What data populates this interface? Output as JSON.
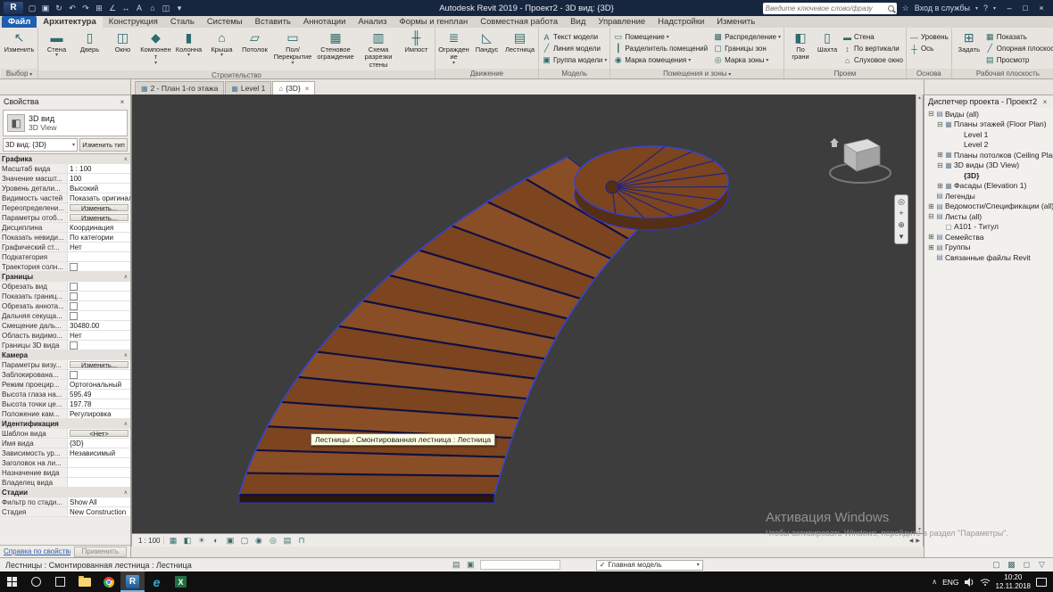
{
  "colors": {
    "titlebar": "#17263f",
    "ribbon_bg": "#e8e5e0",
    "canvas_bg": "#3d3d3d",
    "file_tab": "#1f5fae",
    "tread_brown": "#7c441f",
    "selection_blue": "#3644d0",
    "taskbar_accent": "#76b9ed"
  },
  "titlebar": {
    "app_label": "R",
    "qat": [
      {
        "name": "open",
        "glyph": "▢"
      },
      {
        "name": "save",
        "glyph": "▣"
      },
      {
        "name": "sync",
        "glyph": "↻"
      },
      {
        "name": "undo",
        "glyph": "↶"
      },
      {
        "name": "redo",
        "glyph": "↷"
      },
      {
        "name": "print",
        "glyph": "⊞"
      },
      {
        "name": "measure",
        "glyph": "∠"
      },
      {
        "name": "dimension",
        "glyph": "↔"
      },
      {
        "name": "text",
        "glyph": "A"
      },
      {
        "name": "3d-view",
        "glyph": "⌂"
      },
      {
        "name": "section",
        "glyph": "◫"
      },
      {
        "name": "customize",
        "glyph": "▾"
      }
    ],
    "title": "Autodesk Revit 2019 - Проект2 - 3D вид: {3D}",
    "search_placeholder": "Введите ключевое слово/фразу",
    "star": "☆",
    "signin": "Вход в службы",
    "help": "?",
    "win": {
      "min": "–",
      "max": "□",
      "close": "×"
    }
  },
  "ribbon": {
    "tabs": [
      {
        "label": "Файл",
        "file": true
      },
      {
        "label": "Архитектура",
        "active": true
      },
      {
        "label": "Конструкция"
      },
      {
        "label": "Сталь"
      },
      {
        "label": "Системы"
      },
      {
        "label": "Вставить"
      },
      {
        "label": "Аннотации"
      },
      {
        "label": "Анализ"
      },
      {
        "label": "Формы и генплан"
      },
      {
        "label": "Совместная работа"
      },
      {
        "label": "Вид"
      },
      {
        "label": "Управление"
      },
      {
        "label": "Надстройки"
      },
      {
        "label": "Изменить"
      }
    ],
    "panels": [
      {
        "label": "Выбор",
        "items": [
          {
            "label": "Изменить",
            "glyph": "↖"
          }
        ]
      },
      {
        "label": "Строительство",
        "items": [
          {
            "label": "Стена",
            "glyph": "▬",
            "arrow": true
          },
          {
            "label": "Дверь",
            "glyph": "▯"
          },
          {
            "label": "Окно",
            "glyph": "◫"
          },
          {
            "label": "Компонент",
            "glyph": "◆",
            "arrow": true
          },
          {
            "label": "Колонна",
            "glyph": "▮",
            "arrow": true
          },
          {
            "label": "Крыша",
            "glyph": "⌂",
            "arrow": true
          },
          {
            "label": "Потолок",
            "glyph": "▱"
          },
          {
            "label": "Пол/Перекрытие",
            "glyph": "▭",
            "arrow": true,
            "wide": true
          },
          {
            "label": "Стеновое ограждение",
            "glyph": "▦",
            "wide": true
          },
          {
            "label": "Схема разрезки стены",
            "glyph": "▥",
            "wide": true
          },
          {
            "label": "Импост",
            "glyph": "╫"
          }
        ]
      },
      {
        "label": "Движение",
        "items": [
          {
            "label": "Ограждение",
            "glyph": "≣",
            "arrow": true
          },
          {
            "label": "Пандус",
            "glyph": "◺"
          },
          {
            "label": "Лестница",
            "glyph": "▤"
          }
        ]
      },
      {
        "label": "Модель",
        "items": [
          {
            "label": "Текст модели",
            "glyph": "А"
          },
          {
            "label": "Линия модели",
            "glyph": "╱"
          },
          {
            "label": "Группа модели",
            "glyph": "▣",
            "arrow": true
          }
        ]
      },
      {
        "label": "Помещения и зоны",
        "arrow": true,
        "items": [
          {
            "label": "Помещение",
            "glyph": "▭",
            "arrow": true
          },
          {
            "label": "Разделитель помещений",
            "glyph": "┃"
          },
          {
            "label": "Марка помещения",
            "glyph": "◉",
            "arrow": true
          },
          {
            "label": "Распределение",
            "glyph": "▩",
            "arrow": true
          },
          {
            "label": "Границы зон",
            "glyph": "▢"
          },
          {
            "label": "Марка зоны",
            "glyph": "◎",
            "arrow": true
          }
        ]
      },
      {
        "label": "Проем",
        "big": [
          {
            "label": "По грани",
            "glyph": "◧"
          },
          {
            "label": "Шахта",
            "glyph": "▯"
          }
        ],
        "small": [
          {
            "label": "Стена",
            "glyph": "▬"
          },
          {
            "label": "По вертикали",
            "glyph": "↕"
          },
          {
            "label": "Слуховое окно",
            "glyph": "⌂"
          }
        ]
      },
      {
        "label": "Основа",
        "items": [
          {
            "label": "Уровень",
            "glyph": "—"
          },
          {
            "label": "Ось",
            "glyph": "┼"
          }
        ]
      },
      {
        "label": "Рабочая плоскость",
        "big": [
          {
            "label": "Задать",
            "glyph": "⊞"
          }
        ],
        "small": [
          {
            "label": "Показать",
            "glyph": "▦"
          },
          {
            "label": "Опорная плоскость",
            "glyph": "╱"
          },
          {
            "label": "Просмотр",
            "glyph": "▤"
          }
        ]
      }
    ]
  },
  "properties": {
    "title": "Свойства",
    "close": "×",
    "type_selector": {
      "line1": "3D вид",
      "line2": "3D View",
      "icon_glyph": "◧"
    },
    "instance_combo": "3D вид: {3D}",
    "edit_type": "Изменить тип",
    "rows": [
      {
        "is_section": true,
        "label": "Графика"
      },
      {
        "label": "Масштаб вида",
        "value": "1 : 100"
      },
      {
        "label": "Значение масшт...",
        "value": "100"
      },
      {
        "label": "Уровень детали...",
        "value": "Высокий"
      },
      {
        "label": "Видимость частей",
        "value": "Показать оригинал"
      },
      {
        "label": "Переопределени...",
        "value": "Изменить...",
        "is_button": true
      },
      {
        "label": "Параметры отоб...",
        "value": "Изменить...",
        "is_button": true
      },
      {
        "label": "Дисциплина",
        "value": "Координация"
      },
      {
        "label": "Показать невиди...",
        "value": "По категории"
      },
      {
        "label": "Графический ст...",
        "value": "Нет"
      },
      {
        "label": "Подкатегория",
        "value": ""
      },
      {
        "label": "Траектория солн...",
        "is_checkbox": true
      },
      {
        "is_section": true,
        "label": "Границы"
      },
      {
        "label": "Обрезать вид",
        "is_checkbox": true
      },
      {
        "label": "Показать границ...",
        "is_checkbox": true
      },
      {
        "label": "Обрезать аннота...",
        "is_checkbox": true
      },
      {
        "label": "Дальняя секуща...",
        "is_checkbox": true
      },
      {
        "label": "Смещение даль...",
        "value": "30480.00"
      },
      {
        "label": "Область видимо...",
        "value": "Нет"
      },
      {
        "label": "Границы 3D вида",
        "is_checkbox": true
      },
      {
        "is_section": true,
        "label": "Камера"
      },
      {
        "label": "Параметры визу...",
        "value": "Изменить...",
        "is_button": true
      },
      {
        "label": "Заблокирована...",
        "is_checkbox": true
      },
      {
        "label": "Режим проецир...",
        "value": "Ортогональный"
      },
      {
        "label": "Высота глаза на...",
        "value": "595.49"
      },
      {
        "label": "Высота точки це...",
        "value": "197.78"
      },
      {
        "label": "Положение кам...",
        "value": "Регулировка"
      },
      {
        "is_section": true,
        "label": "Идентификация"
      },
      {
        "label": "Шаблон вида",
        "value": "<Нет>",
        "is_button": true
      },
      {
        "label": "Имя вида",
        "value": "{3D}"
      },
      {
        "label": "Зависимость ур...",
        "value": "Независимый"
      },
      {
        "label": "Заголовок на ли...",
        "value": ""
      },
      {
        "label": "Назначение вида",
        "value": ""
      },
      {
        "label": "Владелец вида",
        "value": ""
      },
      {
        "is_section": true,
        "label": "Стадии"
      },
      {
        "label": "Фильтр по стади...",
        "value": "Show All"
      },
      {
        "label": "Стадия",
        "value": "New Construction"
      }
    ],
    "footer": {
      "help": "Справка по свойствам",
      "apply": "Применить"
    }
  },
  "viewtabs": [
    {
      "icon": "▦",
      "label": "2 - План 1-го этажа"
    },
    {
      "icon": "▦",
      "label": "Level 1"
    },
    {
      "icon": "⌂",
      "label": "{3D}",
      "active": true
    }
  ],
  "canvas": {
    "tooltip": "Лестницы : Смонтированная лестница : Лестница",
    "navbar": [
      {
        "name": "steering-wheel",
        "glyph": "◎"
      },
      {
        "name": "pan",
        "glyph": "+"
      },
      {
        "name": "zoom",
        "glyph": "⊕"
      },
      {
        "name": "more",
        "glyph": "▾"
      }
    ],
    "vscroll": {
      "up": "▲",
      "down": "▼"
    }
  },
  "viewbar": {
    "scale": "1 : 100",
    "icons": [
      {
        "name": "detail-level",
        "glyph": "▦"
      },
      {
        "name": "visual-style",
        "glyph": "◧"
      },
      {
        "name": "sun-path",
        "glyph": "☀"
      },
      {
        "name": "shadows",
        "glyph": "◐"
      },
      {
        "name": "crop-view",
        "glyph": "▣"
      },
      {
        "name": "show-crop",
        "glyph": "▢"
      },
      {
        "name": "temporary-hide-isolate",
        "glyph": "◉"
      },
      {
        "name": "reveal-hidden",
        "glyph": "◎"
      },
      {
        "name": "temporary-view-properties",
        "glyph": "▤"
      },
      {
        "name": "show-constraints",
        "glyph": "⊓"
      }
    ],
    "scroll_left": "◀",
    "scroll_right": "▶"
  },
  "browser": {
    "title": "Диспетчер проекта - Проект2",
    "close": "×",
    "items": [
      {
        "label": "Виды (all)",
        "pad": "3px",
        "exp": "⊟",
        "icon": "▤"
      },
      {
        "label": "Планы этажей (Floor Plan)",
        "pad": "13px",
        "exp": "⊟",
        "icon": "▦"
      },
      {
        "label": "Level 1",
        "pad": "24px",
        "exp": "",
        "icon": ""
      },
      {
        "label": "Level 2",
        "pad": "24px",
        "exp": "",
        "icon": ""
      },
      {
        "label": "Планы потолков (Ceiling Plan)",
        "pad": "13px",
        "exp": "⊞",
        "icon": "▦"
      },
      {
        "label": "3D виды (3D View)",
        "pad": "13px",
        "exp": "⊟",
        "icon": "▦"
      },
      {
        "label": "{3D}",
        "pad": "24px",
        "exp": "",
        "icon": "",
        "bold": true
      },
      {
        "label": "Фасады (Elevation 1)",
        "pad": "13px",
        "exp": "⊞",
        "icon": "▦"
      },
      {
        "label": "Легенды",
        "pad": "3px",
        "exp": "",
        "icon": "▤"
      },
      {
        "label": "Ведомости/Спецификации (all)",
        "pad": "3px",
        "exp": "⊞",
        "icon": "▤"
      },
      {
        "label": "Листы (all)",
        "pad": "3px",
        "exp": "⊟",
        "icon": "▤"
      },
      {
        "label": "A101 - Титул",
        "pad": "13px",
        "exp": "",
        "icon": "▢"
      },
      {
        "label": "Семейства",
        "pad": "3px",
        "exp": "⊞",
        "icon": "▤"
      },
      {
        "label": "Группы",
        "pad": "3px",
        "exp": "⊞",
        "icon": "▤"
      },
      {
        "label": "Связанные файлы Revit",
        "pad": "3px",
        "exp": "",
        "icon": "▤"
      }
    ]
  },
  "statusbar": {
    "message": "Лестницы : Смонтированная лестница : Лестница",
    "left_icons": [
      {
        "name": "worksets",
        "glyph": "▤"
      },
      {
        "name": "design-options",
        "glyph": "▣"
      }
    ],
    "design_option": "Главная модель",
    "check": "✓",
    "right_icons": [
      {
        "name": "editable-only",
        "glyph": "▢"
      },
      {
        "name": "exclude-options",
        "glyph": "▩"
      },
      {
        "name": "press-drag",
        "glyph": "◻"
      },
      {
        "name": "selection-filter",
        "glyph": "▽"
      }
    ]
  },
  "taskbar": {
    "revit_letter": "R",
    "edge_letter": "e",
    "excel_letter": "X",
    "language": "ENG",
    "time": "10:20",
    "date": "12.11.2018"
  },
  "watermark": {
    "line1": "Активация Windows",
    "line2": "Чтобы активировать Windows, перейдите в раздел \"Параметры\"."
  }
}
